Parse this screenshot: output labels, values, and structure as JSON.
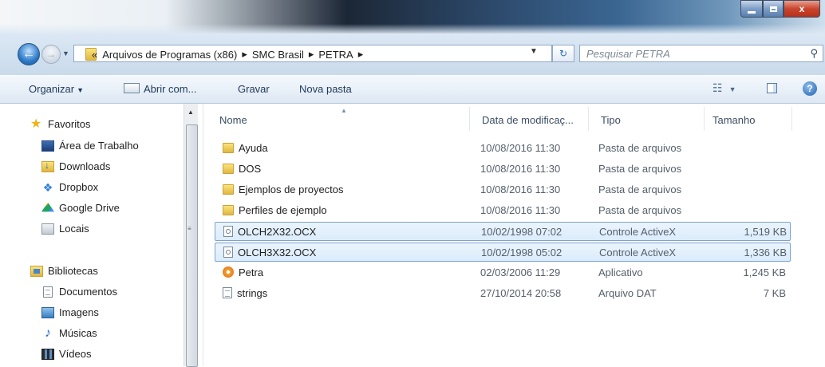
{
  "window": {
    "controls": {
      "minimize": "▁",
      "maximize": "□",
      "close": "x"
    }
  },
  "address": {
    "overflow": "«",
    "crumbs": [
      "Arquivos de Programas (x86)",
      "SMC Brasil",
      "PETRA"
    ],
    "separator": "▸",
    "search_placeholder": "Pesquisar PETRA"
  },
  "toolbar": {
    "organize": "Organizar",
    "open_with": "Abrir com...",
    "burn": "Gravar",
    "new_folder": "Nova pasta",
    "help": "?"
  },
  "sidebar": {
    "favorites": {
      "label": "Favoritos",
      "items": [
        "Área de Trabalho",
        "Downloads",
        "Dropbox",
        "Google Drive",
        "Locais"
      ]
    },
    "libraries": {
      "label": "Bibliotecas",
      "items": [
        "Documentos",
        "Imagens",
        "Músicas",
        "Vídeos"
      ]
    }
  },
  "columns": {
    "name": "Nome",
    "modified": "Data de modificaç...",
    "type": "Tipo",
    "size": "Tamanho"
  },
  "files": [
    {
      "name": "Ayuda",
      "modified": "10/08/2016 11:30",
      "type": "Pasta de arquivos",
      "size": "",
      "kind": "folder",
      "selected": false
    },
    {
      "name": "DOS",
      "modified": "10/08/2016 11:30",
      "type": "Pasta de arquivos",
      "size": "",
      "kind": "folder",
      "selected": false
    },
    {
      "name": "Ejemplos de proyectos",
      "modified": "10/08/2016 11:30",
      "type": "Pasta de arquivos",
      "size": "",
      "kind": "folder",
      "selected": false
    },
    {
      "name": "Perfiles de ejemplo",
      "modified": "10/08/2016 11:30",
      "type": "Pasta de arquivos",
      "size": "",
      "kind": "folder",
      "selected": false
    },
    {
      "name": "OLCH2X32.OCX",
      "modified": "10/02/1998 07:02",
      "type": "Controle ActiveX",
      "size": "1,519 KB",
      "kind": "ocx",
      "selected": true
    },
    {
      "name": "OLCH3X32.OCX",
      "modified": "10/02/1998 05:02",
      "type": "Controle ActiveX",
      "size": "1,336 KB",
      "kind": "ocx",
      "selected": true
    },
    {
      "name": "Petra",
      "modified": "02/03/2006 11:29",
      "type": "Aplicativo",
      "size": "1,245 KB",
      "kind": "app",
      "selected": false
    },
    {
      "name": "strings",
      "modified": "27/10/2014 20:58",
      "type": "Arquivo DAT",
      "size": "7 KB",
      "kind": "dat",
      "selected": false
    }
  ]
}
